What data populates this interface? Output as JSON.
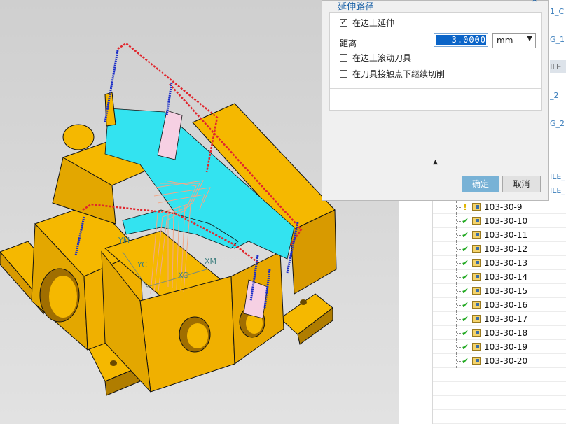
{
  "dialog": {
    "title": "延伸路径",
    "collapse_icon": "chevron-up-icon",
    "extend_on_edge_label": "在边上延伸",
    "extend_on_edge_checked": true,
    "distance_label": "距离",
    "distance_value": "3.0000",
    "unit_value": "mm",
    "roll_tool_label": "在边上滚动刀具",
    "roll_tool_checked": false,
    "continue_cut_label": "在刀具接触点下继续切削",
    "continue_cut_checked": false,
    "ok_label": "确定",
    "cancel_label": "取消",
    "colors": {
      "title": "#1b62a7",
      "ok_button": "#78b2d6"
    }
  },
  "navigator": {
    "partial_right_labels": [
      "1_C",
      "G_1",
      "ILE",
      "_2",
      "G_2",
      "ILE_",
      "ILE_"
    ],
    "operations": [
      {
        "name": "103-30-9",
        "status": "warning"
      },
      {
        "name": "103-30-10",
        "status": "complete"
      },
      {
        "name": "103-30-11",
        "status": "complete"
      },
      {
        "name": "103-30-12",
        "status": "complete"
      },
      {
        "name": "103-30-13",
        "status": "complete"
      },
      {
        "name": "103-30-14",
        "status": "complete"
      },
      {
        "name": "103-30-15",
        "status": "complete"
      },
      {
        "name": "103-30-16",
        "status": "complete"
      },
      {
        "name": "103-30-17",
        "status": "complete"
      },
      {
        "name": "103-30-18",
        "status": "complete"
      },
      {
        "name": "103-30-19",
        "status": "complete"
      },
      {
        "name": "103-30-20",
        "status": "complete"
      }
    ]
  },
  "viewport": {
    "axis_labels": [
      "YM",
      "YC",
      "XC",
      "XM"
    ],
    "colors": {
      "part": "#f5b800",
      "part_dark": "#b07d00",
      "floor": "#33e3f0",
      "path_rapid": "#e0262d",
      "path_cut": "#1b2ec8",
      "tool": "#f1a88a"
    }
  }
}
